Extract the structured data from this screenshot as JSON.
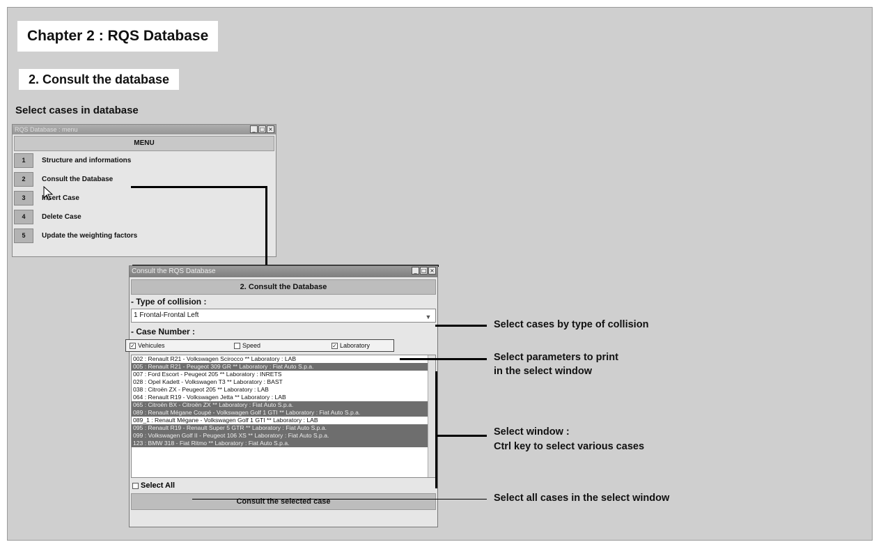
{
  "slide": {
    "title": "Chapter 2 : RQS Database",
    "subtitle": "2. Consult the database",
    "select_heading": "Select cases in database"
  },
  "menu_window": {
    "title": "RQS Database : menu",
    "header": "MENU",
    "items": [
      {
        "num": "1",
        "label": "Structure and informations"
      },
      {
        "num": "2",
        "label": "Consult the Database"
      },
      {
        "num": "3",
        "label": "Insert Case"
      },
      {
        "num": "4",
        "label": "Delete Case"
      },
      {
        "num": "5",
        "label": "Update the weighting factors"
      }
    ],
    "controls": [
      "_",
      "□",
      "×"
    ]
  },
  "consult_window": {
    "title": "Consult the RQS Database",
    "header": "2. Consult the Database",
    "type_label": "- Type of collision :",
    "type_value": "1 Frontal-Frontal Left",
    "case_label": "- Case Number :",
    "checkboxes": [
      {
        "label": "Vehicules",
        "checked": true
      },
      {
        "label": "Speed",
        "checked": false
      },
      {
        "label": "Laboratory",
        "checked": true
      }
    ],
    "cases": [
      {
        "text": "002 : Renault R21 - Volkswagen Scirocco  **  Laboratory : LAB",
        "selected": false
      },
      {
        "text": "005 : Renault R21 - Peugeot 309 GR  **  Laboratory : Fiat Auto S.p.a.",
        "selected": true
      },
      {
        "text": "007 : Ford Escort - Peugeot 205  **  Laboratory : INRETS",
        "selected": false
      },
      {
        "text": "028 : Opel Kadett - Volkswagen T3  **  Laboratory : BAST",
        "selected": false
      },
      {
        "text": "038 : Citroën ZX - Peugeot 205  **  Laboratory : LAB",
        "selected": false
      },
      {
        "text": "064 : Renault R19 - Volkswagen Jetta  **  Laboratory : LAB",
        "selected": false
      },
      {
        "text": "065 : Citroën BX - Citroën ZX  **  Laboratory : Fiat Auto S.p.a.",
        "selected": true
      },
      {
        "text": "089 : Renault Mégane Coupé - Volkswagen Golf 1 GTI  **  Laboratory : Fiat Auto S.p.a.",
        "selected": true
      },
      {
        "text": "089_1 : Renault Mégane - Volkswagen Golf 1 GTI  **  Laboratory : LAB",
        "selected": false
      },
      {
        "text": "095 : Renault R19 - Renault Super 5 GTR  **  Laboratory : Fiat Auto S.p.a.",
        "selected": true
      },
      {
        "text": "099 : Volkswagen Golf II - Peugeot 106 XS  **  Laboratory : Fiat Auto S.p.a.",
        "selected": true
      },
      {
        "text": "123 : BMW 318 - Fiat Ritmo  **  Laboratory : Fiat Auto S.p.a.",
        "selected": true
      }
    ],
    "select_all_label": "Select All",
    "consult_button": "Consult the selected case"
  },
  "annotations": {
    "type": "Select cases by type of collision",
    "params_line1": "Select parameters to print",
    "params_line2": "in the select window",
    "window_line1": "Select window :",
    "window_line2": "Ctrl key to select various cases",
    "all": "Select all cases in the select window"
  }
}
